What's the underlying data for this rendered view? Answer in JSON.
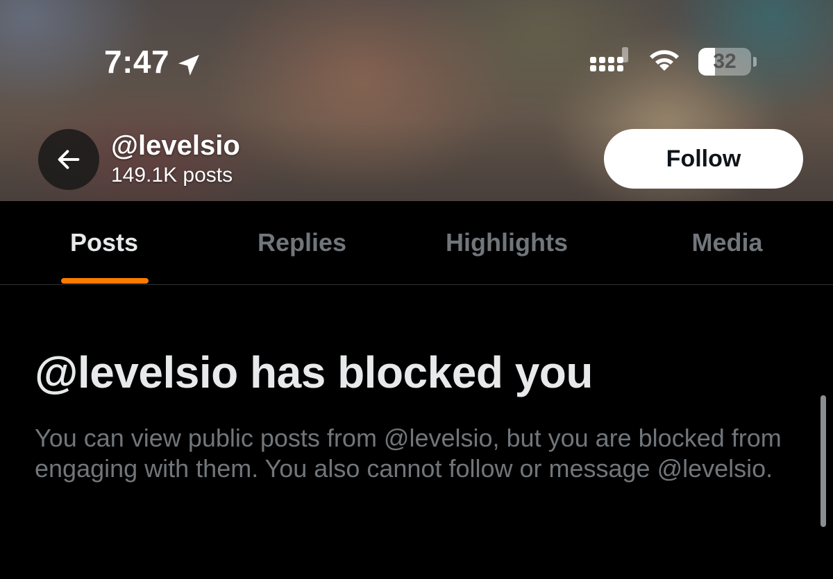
{
  "status_bar": {
    "time": "7:47",
    "battery_level": "32",
    "battery_fraction": 0.32
  },
  "profile": {
    "handle": "@levelsio",
    "post_count": "149.1K posts",
    "follow_label": "Follow"
  },
  "tabs": [
    {
      "label": "Posts",
      "active": true
    },
    {
      "label": "Replies",
      "active": false
    },
    {
      "label": "Highlights",
      "active": false
    },
    {
      "label": "Media",
      "active": false
    }
  ],
  "notice": {
    "title": "@levelsio has blocked you",
    "body": "You can view public posts from @levelsio, but you are blocked from engaging with them. You also cannot follow or message @levelsio."
  },
  "colors": {
    "accent": "#ff7a00",
    "background": "#000000",
    "secondary_text": "#71767b"
  }
}
